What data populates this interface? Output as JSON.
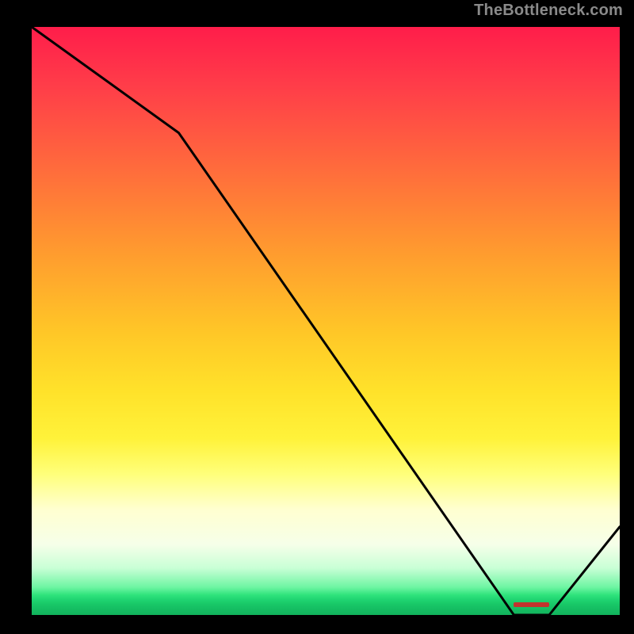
{
  "watermark": "TheBottleneck.com",
  "chart_data": {
    "type": "line",
    "title": "",
    "xlabel": "",
    "ylabel": "",
    "xlim": [
      0,
      100
    ],
    "ylim": [
      0,
      100
    ],
    "x": [
      0,
      25,
      82,
      88,
      100
    ],
    "values": [
      100,
      82,
      0,
      0,
      15
    ],
    "optimal_band": {
      "start_x": 82,
      "end_x": 88
    },
    "background_gradient": {
      "top": "#ff1d4a",
      "bottom": "#12b25c",
      "zero_color": "#2fe37c"
    }
  }
}
